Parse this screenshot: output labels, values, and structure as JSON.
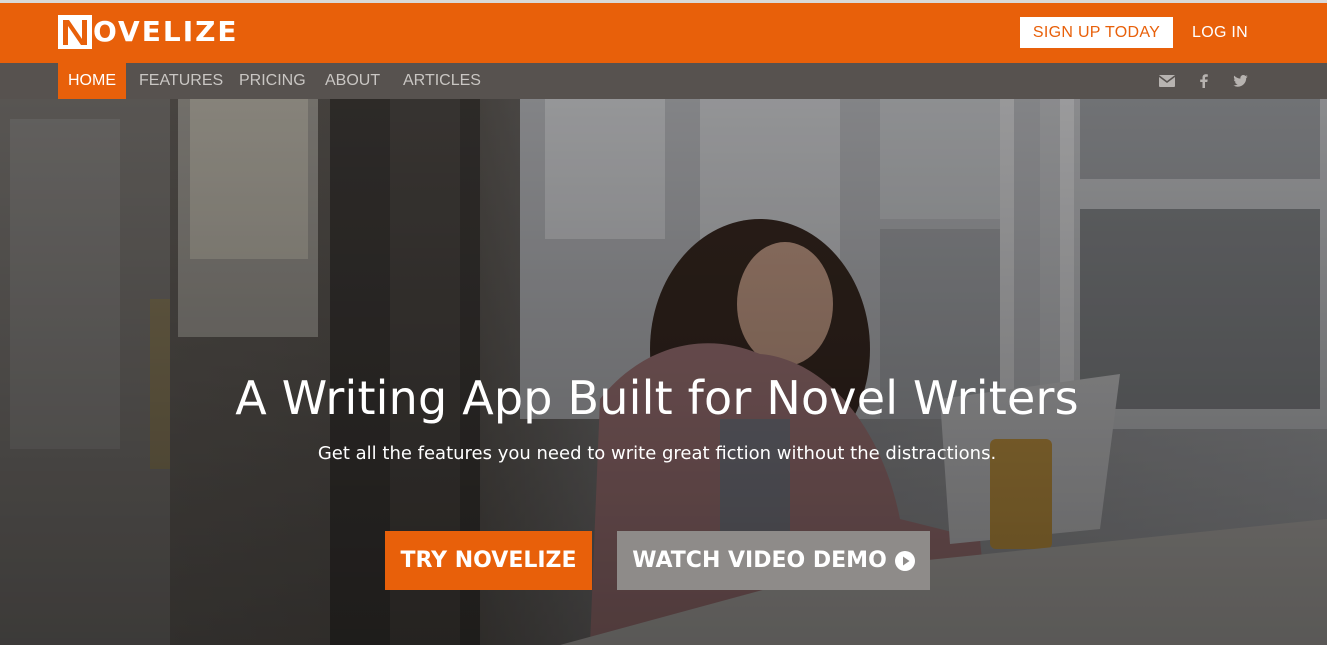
{
  "header": {
    "logo_text": "OVELIZE",
    "logo_letter": "N",
    "signup_label": "SIGN UP TODAY",
    "login_label": "LOG IN"
  },
  "nav": {
    "items": [
      {
        "label": "HOME",
        "active": true
      },
      {
        "label": "FEATURES",
        "active": false
      },
      {
        "label": "PRICING",
        "active": false
      },
      {
        "label": "ABOUT",
        "active": false
      },
      {
        "label": "ARTICLES",
        "active": false
      }
    ],
    "social": [
      "envelope-icon",
      "facebook-icon",
      "twitter-icon"
    ]
  },
  "hero": {
    "title": "A Writing App Built for Novel Writers",
    "subtitle": "Get all the features you need to write great fiction without the distractions.",
    "primary_button": "TRY NOVELIZE",
    "secondary_button": "WATCH VIDEO DEMO"
  },
  "colors": {
    "brand_orange": "#e8600a",
    "nav_bg": "#57524f",
    "demo_button_bg": "#8e8b89"
  }
}
